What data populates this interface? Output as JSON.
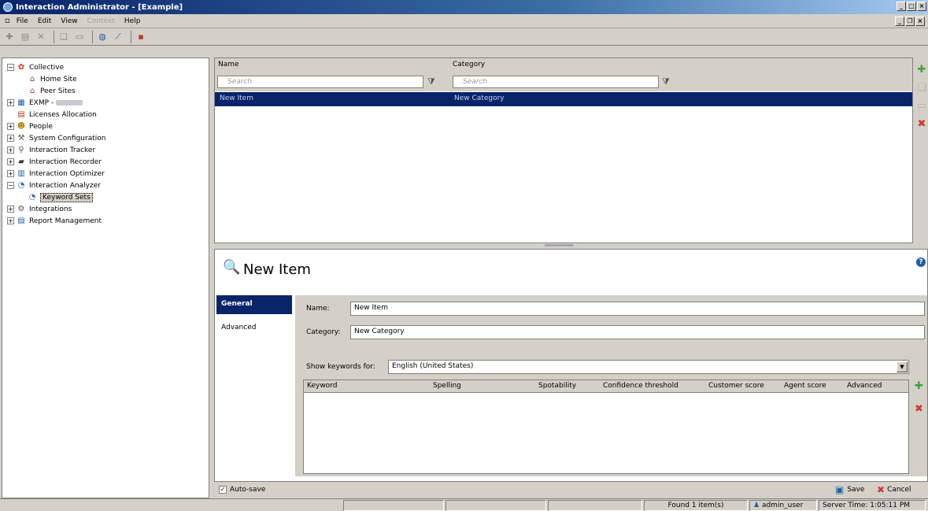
{
  "window": {
    "title": "Interaction Administrator - [Example]"
  },
  "menu": {
    "items": [
      "File",
      "Edit",
      "View",
      "Context",
      "Help"
    ],
    "disabled_index": 3
  },
  "tree": {
    "items": [
      {
        "label": "Collective",
        "indent": 0,
        "exp": "⊟",
        "icon": "collective-icon"
      },
      {
        "label": "Home Site",
        "indent": 1,
        "exp": "",
        "icon": "home-site-icon"
      },
      {
        "label": "Peer Sites",
        "indent": 1,
        "exp": "",
        "icon": "peer-sites-icon"
      },
      {
        "label": "EXMP -",
        "indent": 0,
        "exp": "⊞",
        "icon": "server-icon",
        "blurred": true
      },
      {
        "label": "Licenses Allocation",
        "indent": 0,
        "exp": "",
        "icon": "license-icon"
      },
      {
        "label": "People",
        "indent": 0,
        "exp": "⊞",
        "icon": "people-icon"
      },
      {
        "label": "System Configuration",
        "indent": 0,
        "exp": "⊞",
        "icon": "wrench-icon"
      },
      {
        "label": "Interaction Tracker",
        "indent": 0,
        "exp": "⊞",
        "icon": "tracker-icon"
      },
      {
        "label": "Interaction Recorder",
        "indent": 0,
        "exp": "⊞",
        "icon": "recorder-icon"
      },
      {
        "label": "Interaction Optimizer",
        "indent": 0,
        "exp": "⊞",
        "icon": "optimizer-icon"
      },
      {
        "label": "Interaction Analyzer",
        "indent": 0,
        "exp": "⊟",
        "icon": "analyzer-icon"
      },
      {
        "label": "Keyword Sets",
        "indent": 1,
        "exp": "",
        "icon": "keyword-sets-icon",
        "selected": true
      },
      {
        "label": "Integrations",
        "indent": 0,
        "exp": "⊞",
        "icon": "integrations-icon"
      },
      {
        "label": "Report Management",
        "indent": 0,
        "exp": "⊞",
        "icon": "report-icon"
      }
    ]
  },
  "grid": {
    "col_name": "Name",
    "col_category": "Category",
    "search_placeholder": "Search",
    "row": {
      "name": "New Item",
      "category": "New Category"
    }
  },
  "detail": {
    "title": "New Item",
    "tabs": [
      "General",
      "Advanced"
    ],
    "name_label": "Name:",
    "name_value": "New Item",
    "category_label": "Category:",
    "category_value": "New Category",
    "show_keywords_label": "Show keywords for:",
    "language_value": "English (United States)",
    "kw_columns": [
      "Keyword",
      "Spelling",
      "Spotability",
      "Confidence threshold",
      "Customer score",
      "Agent score",
      "Advanced"
    ]
  },
  "bottom": {
    "autosave_label": "Auto-save",
    "save_label": "Save",
    "cancel_label": "Cancel"
  },
  "status": {
    "found": "Found 1 item(s)",
    "user": "admin_user",
    "server_time": "Server Time: 1:05:11 PM"
  }
}
